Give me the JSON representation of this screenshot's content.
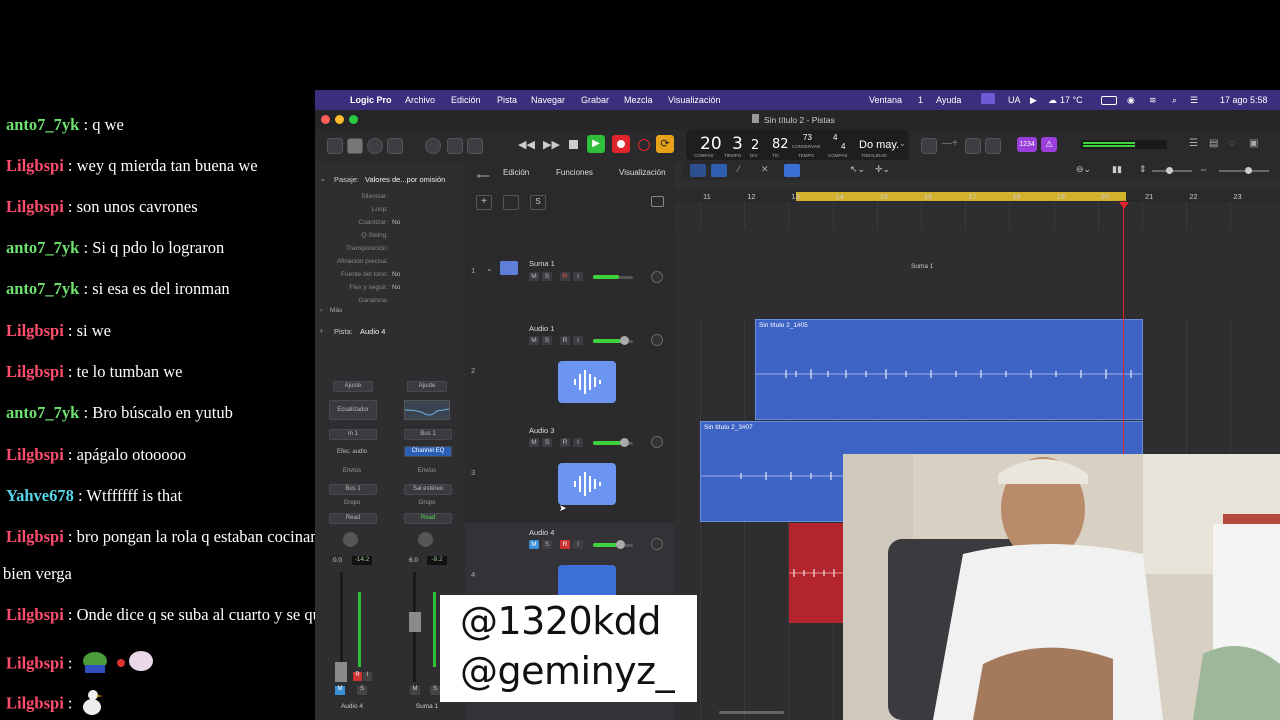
{
  "chat": [
    {
      "user": "anto7_7yk",
      "color": "#6ee26e",
      "message": "q we"
    },
    {
      "user": "Lilgbspi",
      "color": "#ff4d6d",
      "message": "wey q mierda tan buena we"
    },
    {
      "user": "Lilgbspi",
      "color": "#ff4d6d",
      "message": "son unos cavrones"
    },
    {
      "user": "anto7_7yk",
      "color": "#6ee26e",
      "message": "Si q pdo lo lograron"
    },
    {
      "user": "anto7_7yk",
      "color": "#6ee26e",
      "message": "si esa es del ironman"
    },
    {
      "user": "Lilgbspi",
      "color": "#ff4d6d",
      "message": "si we"
    },
    {
      "user": "Lilgbspi",
      "color": "#ff4d6d",
      "message": "te lo tumban we"
    },
    {
      "user": "anto7_7yk",
      "color": "#6ee26e",
      "message": "Bro búscalo en yutub"
    },
    {
      "user": "Lilgbspi",
      "color": "#ff4d6d",
      "message": "apágalo otooooo"
    },
    {
      "user": "Yahve678",
      "color": "#55d6e8",
      "message": "Wtffffff is that"
    },
    {
      "user": "Lilgbspi",
      "color": "#ff4d6d",
      "message": "bro pongan la rola q estaban cocinando hace rato está"
    },
    {
      "user": "",
      "color": "#ffffff",
      "message": "bien verga"
    },
    {
      "user": "Lilgbspi",
      "color": "#ff4d6d",
      "message": "Onde dice q se suba al cuarto y se quite los Valen"
    },
    {
      "user": "Lilgbspi",
      "color": "#ff4d6d",
      "message": ""
    },
    {
      "user": "Lilgbspi",
      "color": "#ff4d6d",
      "message": ""
    }
  ],
  "menubar": {
    "app": "Logic Pro",
    "items": [
      "Archivo",
      "Edición",
      "Pista",
      "Navegar",
      "Grabar",
      "Mezcla",
      "Visualización"
    ],
    "right": [
      "Ventana",
      "1",
      "Ayuda"
    ],
    "status": {
      "lang": "UA",
      "temp": "17 °C",
      "datetime": "17 ago 5:58"
    }
  },
  "window_title": "Sin título 2 - Pistas",
  "lcd": {
    "bar": "20",
    "beat": "3",
    "div": "2",
    "tempo": "82",
    "tempo_top": "73",
    "sig_top": "4",
    "sig_bottom": "4",
    "key": "Do may.",
    "labels": {
      "compas": "COMPÁS",
      "tiempo": "TIEMPO",
      "div": "DIV",
      "tic": "TIC",
      "conservar": "CONSERVAR",
      "tempo": "TEMPO",
      "compas2": "COMPÁS",
      "tonalidad": "TONALIDAD"
    }
  },
  "toolbar_badge": "1234",
  "inspector": {
    "region_header": "Pasaje:",
    "region_value": "Valores de...por omisión",
    "params": [
      {
        "label": "Silenciar:",
        "value": ""
      },
      {
        "label": "Loop:",
        "value": ""
      },
      {
        "label": "Cuantizar:",
        "value": "No"
      },
      {
        "label": "Q-Swing:",
        "value": ""
      },
      {
        "label": "Transposición:",
        "value": ""
      },
      {
        "label": "Afinación precisa:",
        "value": ""
      },
      {
        "label": "Fuente del tono:",
        "value": "No"
      },
      {
        "label": "Flex y seguir:",
        "value": "No"
      },
      {
        "label": "Ganancia:",
        "value": ""
      }
    ],
    "mas": "Más",
    "track_header": "Pista:",
    "track_value": "Audio 4",
    "strip_left": {
      "ajuste": "Ajuste",
      "eq": "Ecualizador",
      "input": "In 1",
      "fx": "Efec. audio",
      "envios": "Envíos",
      "output": "Bus 1",
      "grupo": "Grupo",
      "auto": "Read",
      "vol": "0.0",
      "peak": "-14.2",
      "name": "Audio 4"
    },
    "strip_right": {
      "ajuste": "Ajuste",
      "input": "Bus 1",
      "plugin": "Channel EQ",
      "envios": "Envíos",
      "output": "Sal estéreo",
      "grupo": "Grupo",
      "auto": "Read",
      "vol": "6.0",
      "peak": "-9.2",
      "name": "Suma 1"
    }
  },
  "track_menu": {
    "edicion": "Edición",
    "funciones": "Funciones",
    "visualizacion": "Visualización"
  },
  "tracks": [
    {
      "num": "1",
      "name": "Suma 1"
    },
    {
      "num": "2",
      "name": "Audio 1"
    },
    {
      "num": "3",
      "name": "Audio 3"
    },
    {
      "num": "4",
      "name": "Audio 4"
    }
  ],
  "ruler": [
    "11",
    "12",
    "13",
    "14",
    "15",
    "16",
    "17",
    "18",
    "19",
    "20",
    "21",
    "22",
    "23"
  ],
  "regions": {
    "suma": "Suma 1",
    "audio1": "Sin título 2_1#05",
    "audio3": "Sin título 2_3#07"
  },
  "handles": [
    "@1320kdd",
    "@geminyz_"
  ]
}
